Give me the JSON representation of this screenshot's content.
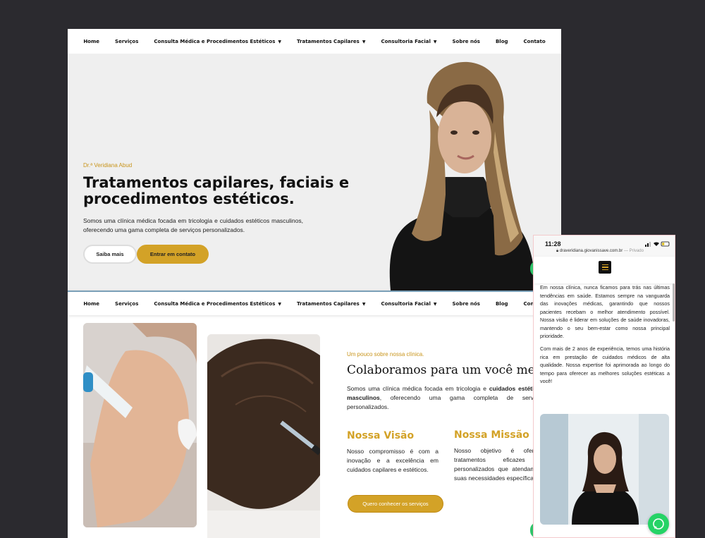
{
  "nav": {
    "items": [
      {
        "label": "Home",
        "dropdown": false
      },
      {
        "label": "Serviços",
        "dropdown": false
      },
      {
        "label": "Consulta Médica e Procedimentos Estéticos",
        "dropdown": true
      },
      {
        "label": "Tratamentos Capilares",
        "dropdown": true
      },
      {
        "label": "Consultoria Facial",
        "dropdown": true
      },
      {
        "label": "Sobre nós",
        "dropdown": false
      },
      {
        "label": "Blog",
        "dropdown": false
      },
      {
        "label": "Contato",
        "dropdown": false
      }
    ],
    "caret_icon": "chevron-down-icon"
  },
  "hero": {
    "kicker": "Dr.ª Veridiana Abud",
    "title": "Tratamentos capilares, faciais e procedimentos estéticos.",
    "description": "Somos uma clínica médica focada em tricologia e cuidados estéticos masculinos, oferecendo uma gama completa de serviços personalizados.",
    "btn_more": "Saiba mais",
    "btn_contact": "Entrar em contato"
  },
  "about": {
    "kicker": "Um pouco sobre nossa clínica.",
    "title": "Colaboramos para um você melhor",
    "desc_start": "Somos uma clínica médica focada em tricologia e ",
    "desc_bold": "cuidados estéticos masculinos",
    "desc_end": ", oferecendo uma gama completa de serviços personalizados.",
    "vision_title": "Nossa Visão",
    "vision_text": "Nosso compromisso é com a inovação e a excelência em cuidados capilares e estéticos.",
    "mission_title": "Nossa Missão",
    "mission_text": "Nosso objetivo é oferecer tratamentos eficazes e personalizados que atendam às suas necessidades específicas.",
    "btn_services": "Quero conhecer os serviços"
  },
  "mobile": {
    "time": "11:28",
    "url": "draveridiana.giovanissave.com.br",
    "url_note": "— Privado",
    "para1": "Em nossa clínica, nunca ficamos para trás nas últimas tendências em saúde. Estamos sempre na vanguarda das inovações médicas, garantindo que nossos pacientes recebam o melhor atendimento possível. Nossa visão é liderar em soluções de saúde inovadoras, mantendo o seu bem-estar como nossa principal prioridade.",
    "para2": "Com mais de 2 anos de experiência, temos uma história rica em prestação de cuidados médicos de alta qualidade. Nossa expertise foi aprimorada ao longo do tempo para oferecer as melhores soluções estéticas a você!"
  },
  "colors": {
    "accent": "#d3a227",
    "background": "#2b2a2f",
    "hero_bg": "#efefef",
    "whatsapp": "#25d366"
  }
}
